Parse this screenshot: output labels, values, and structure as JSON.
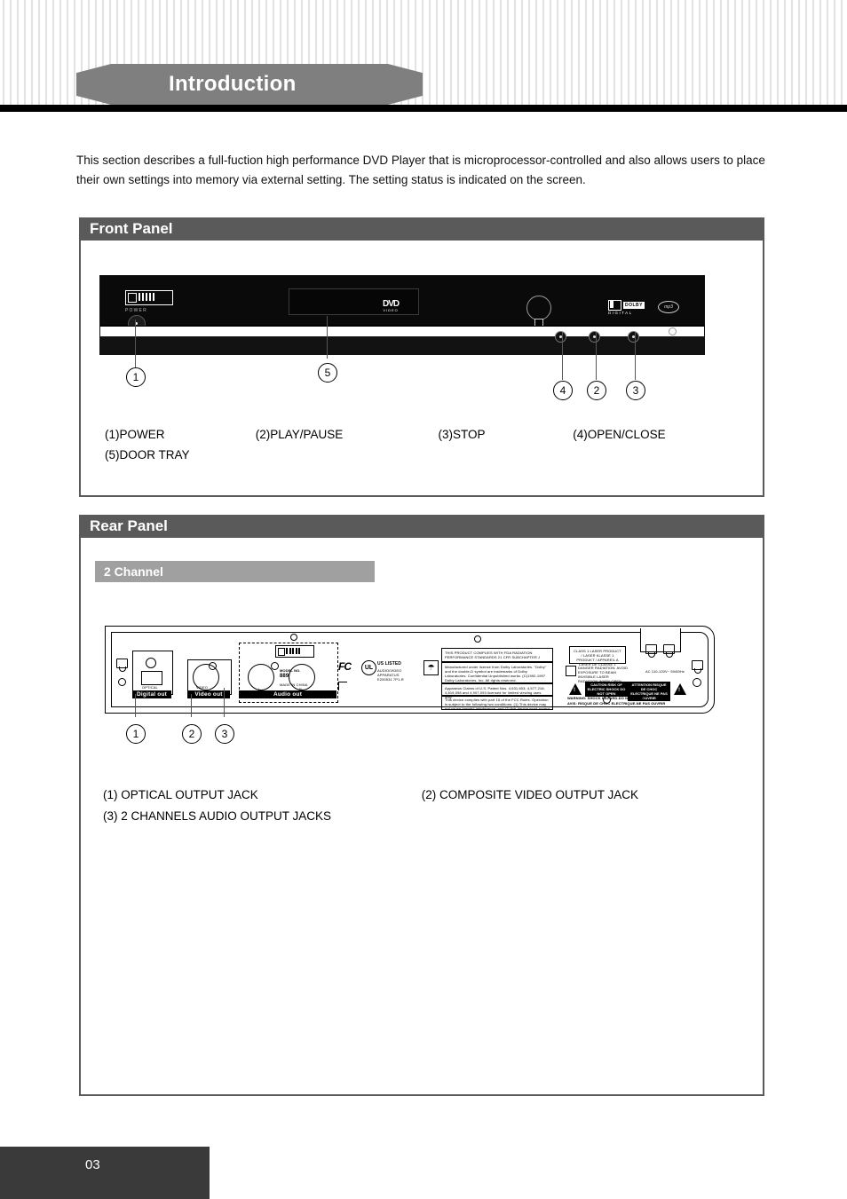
{
  "page": {
    "banner_title": "Introduction",
    "page_number": "03",
    "intro_text": "This section describes a full-fuction high performance DVD Player that is microprocessor-controlled and also allows users to place their own settings into memory via external setting. The setting status is indicated on the screen."
  },
  "front_panel": {
    "header": "Front Panel",
    "callouts": [
      "1",
      "5",
      "4",
      "2",
      "3"
    ],
    "device": {
      "brand_logo": "amw",
      "power_label": "POWER",
      "disc_logo_main": "DVD",
      "disc_logo_sub": "VIDEO",
      "dolby_word": "DOLBY",
      "dolby_sub": "DIGITAL",
      "mp3_logo": "mp3"
    },
    "legend": [
      "(1)POWER",
      "(2)PLAY/PAUSE",
      "(3)STOP",
      "(4)OPEN/CLOSE",
      "(5)DOOR TRAY"
    ]
  },
  "rear_panel": {
    "header": "Rear Panel",
    "sub_header": "2 Channel",
    "callouts": [
      "1",
      "2",
      "3"
    ],
    "device": {
      "brand_logo": "amw",
      "digital_out_label": "Digital out",
      "digital_out_sub": "OPTICAL",
      "video_out_label": "Video out",
      "video_out_sub": "VIDEO",
      "audio_out_label": "Audio out",
      "audio_left": "L",
      "audio_right": "R",
      "model_no_label": "MODEL NO.",
      "model_no_value": "889",
      "made_in": "MADE IN CHINA",
      "fcc_mark": "FC",
      "ul_mark": "UL",
      "ul_text": "US LISTED",
      "ul_sub": "AUDIO/VIDEO APPARATUS E200531 7P1-R",
      "reg_text_1": "THIS PRODUCT COMPLIES WITH FDA RADIATION PERFORMANCE STANDARDS 21 CFR SUBCHAPTER J",
      "reg_text_2": "Manufactured under license from Dolby Laboratories. \"Dolby\" and the double-D symbol are trademarks of Dolby Laboratories. Confidential Unpublished works. (C)1992-1997 Dolby Laboratories, Inc. All rights reserved.",
      "reg_text_3": "Apparatus Claims of U.S. Patent Nos. 4,631,603; 4,577,216; 4,819,098 and 4,907,093 licensed for limited viewing uses only.",
      "reg_text_4": "This device complies with part 15 of the FCC Rules. Operation is subject to the following two conditions: (1) This device may not cause harmful interference, and (2) this device must accept any interference received, including interference that may cause undesired operation.",
      "laser_text": "CLASS 1 LASER PRODUCT / LASER KLASSE 1 PRODUKT / APPAREIL A LASER DE CLASSE 1",
      "laser_warn": "DANGER RADIATION: AVOID EXPOSURE TO BEAM INVISIBLE LASER RADIATION WHEN OPEN",
      "power_rating": "AC 110-120V~ 50/60Hz",
      "caution_en": "CAUTION RISK OF ELECTRIC SHOCK DO NOT OPEN",
      "caution_fr": "ATTENTION RISQUE DE CHOC ELECTRIQUE NE PAS OUVRIR",
      "warning_en": "WARNING: SHOCK HAZARD-DO NOT OPEN",
      "warning_fr": "AVIS: RISQUE DE CHOC ELECTRIQUE-NE PAS OUVRIR"
    },
    "legend": [
      "(1) OPTICAL  OUTPUT  JACK",
      "(2) COMPOSITE  VIDEO  OUTPUT  JACK",
      "(3) 2 CHANNELS  AUDIO  OUTPUT  JACKS"
    ]
  }
}
